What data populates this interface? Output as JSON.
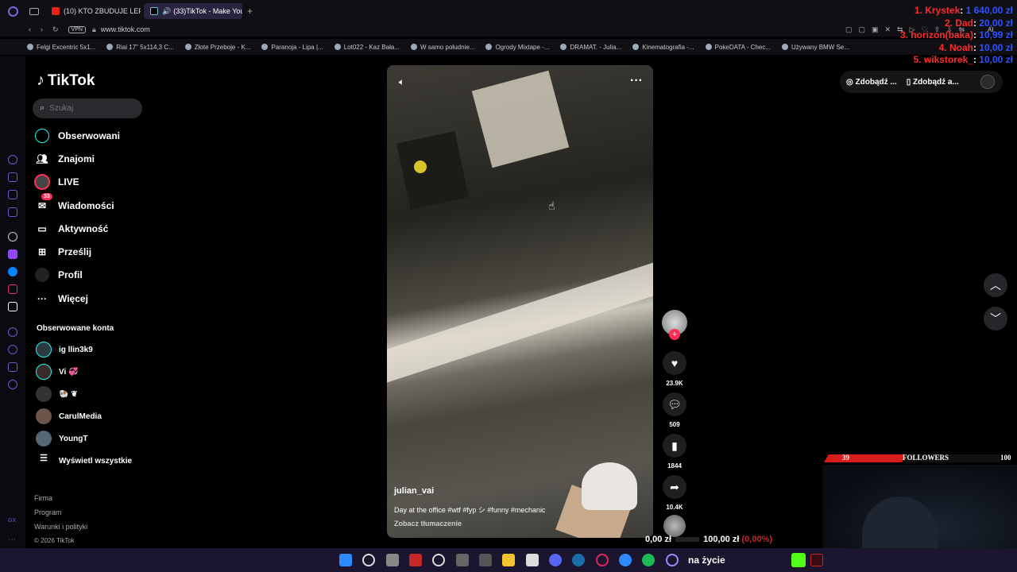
{
  "browser": {
    "tabs": [
      {
        "label": "(10) KTO ZBUDUJE LEPSZ",
        "icon": "youtube-icon",
        "active": false
      },
      {
        "label": "(33)TikTok - Make You",
        "icon": "tiktok-icon",
        "active": true
      }
    ],
    "new_tab": "+",
    "vpn": "VPN",
    "url": "www.tiktok.com",
    "toolbar_ai": "AI",
    "bookmarks": [
      "Felgi Excentric 5x1...",
      "Riai 17\" 5x114,3 C...",
      "Złote Przeboje - K...",
      "Paranoja - Lipa |...",
      "Lot022 - Kaz Bała...",
      "W samo południe...",
      "Ogrody Mixtape -...",
      "DRAMAT. - Julia...",
      "Kinematografia -...",
      "PokeDATA - Chec...",
      "Używany BMW Se..."
    ]
  },
  "tiktok": {
    "logo": "TikTok",
    "search_placeholder": "Szukaj",
    "nav": [
      {
        "label": "Obserwowani",
        "icon": "following-icon"
      },
      {
        "label": "Znajomi",
        "icon": "friends-icon"
      },
      {
        "label": "LIVE",
        "icon": "live-icon"
      },
      {
        "label": "Wiadomości",
        "icon": "messages-icon",
        "badge": "33"
      },
      {
        "label": "Aktywność",
        "icon": "activity-icon"
      },
      {
        "label": "Prześlij",
        "icon": "upload-icon"
      },
      {
        "label": "Profil",
        "icon": "profile-icon"
      },
      {
        "label": "Więcej",
        "icon": "more-icon"
      }
    ],
    "followed_title": "Obserwowane konta",
    "followed": [
      {
        "name": "ig llin3k9"
      },
      {
        "name": "Vi 💞"
      },
      {
        "name": "🐏 ❦"
      },
      {
        "name": "CarulMedia"
      },
      {
        "name": "YoungT"
      }
    ],
    "show_all": "Wyświetl wszystkie",
    "footer": [
      "Firma",
      "Program",
      "Warunki i polityki",
      "© 2026 TikTok"
    ],
    "get_buttons": [
      "Zdobądź ...",
      "Zdobądź a..."
    ],
    "video": {
      "username": "julian_vai",
      "description": "Day at the office #wtf #fyp シ #funny #mechanic",
      "translate": "Zobacz tłumaczenie"
    },
    "actions": {
      "likes": "23.9K",
      "comments": "509",
      "saves": "1844",
      "shares": "10.4K"
    }
  },
  "stream": {
    "donors": [
      {
        "name": "1. Krystek",
        "amount": "1 640,00 zł"
      },
      {
        "name": "2. Dad",
        "amount": "20,00 zł"
      },
      {
        "name": "3. horizon(baka)",
        "amount": "10,99 zł"
      },
      {
        "name": "4. Noah",
        "amount": "10,00 zł"
      },
      {
        "name": "5. wikstorek_",
        "amount": "10,00 zł"
      }
    ],
    "followers": {
      "current": "39",
      "label": "FOLLOWERS",
      "goal": "100",
      "progress": 0.39
    },
    "goal": {
      "current": "0,00 zł",
      "target": "100,00 zł",
      "percent": "(0,00%)"
    },
    "taskbar_text": "na życie"
  },
  "colors": {
    "accent_red": "#fe2c55",
    "donor_name": "#ff2a2a",
    "donor_amount": "#2f52ff"
  }
}
